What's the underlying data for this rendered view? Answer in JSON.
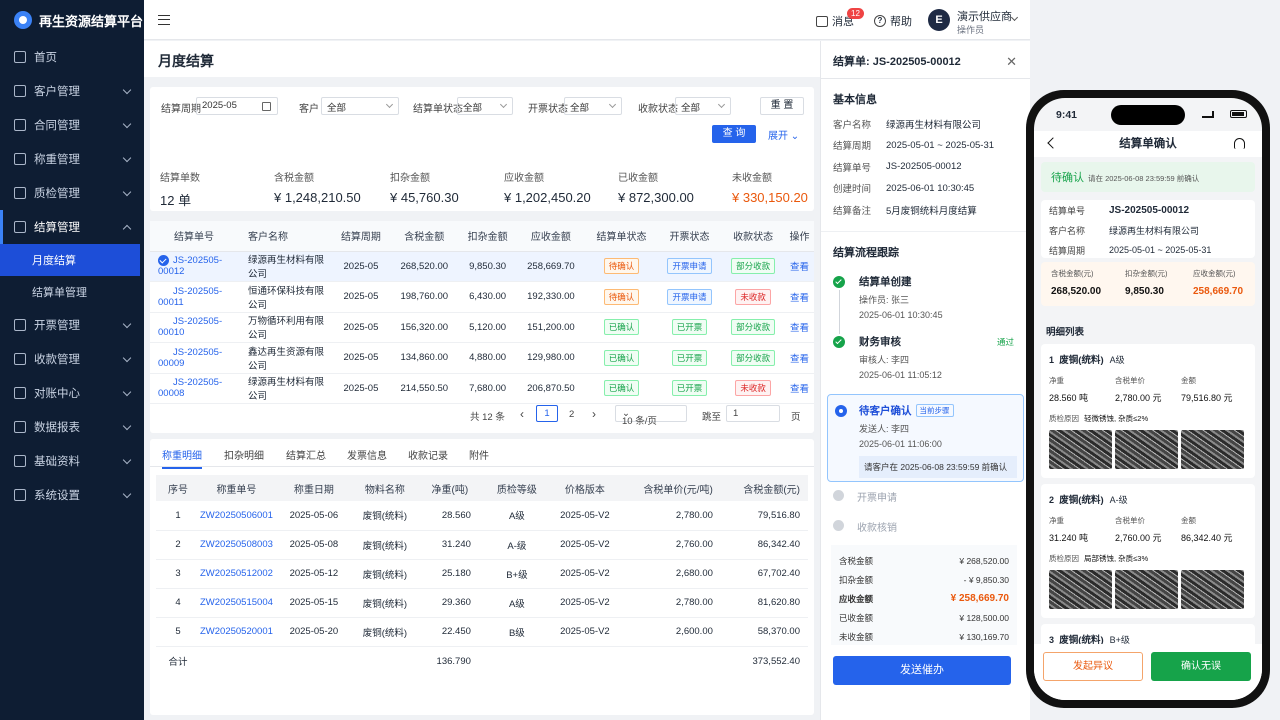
{
  "app": {
    "title": "再生资源结算平台"
  },
  "sidebar": {
    "items": [
      {
        "label": "首页"
      },
      {
        "label": "客户管理"
      },
      {
        "label": "合同管理"
      },
      {
        "label": "称重管理"
      },
      {
        "label": "质检管理"
      },
      {
        "label": "结算管理"
      },
      {
        "label": "月度结算"
      },
      {
        "label": "结算单管理"
      },
      {
        "label": "开票管理"
      },
      {
        "label": "收款管理"
      },
      {
        "label": "对账中心"
      },
      {
        "label": "数据报表"
      },
      {
        "label": "基础资料"
      },
      {
        "label": "系统设置"
      }
    ]
  },
  "topbar": {
    "messages": "消息",
    "message_count": "12",
    "help": "帮助",
    "avatar_letter": "E",
    "user_name": "演示供应商",
    "user_role": "操作员"
  },
  "page": {
    "title": "月度结算"
  },
  "filter": {
    "period_label": "结算周期",
    "period_value": "2025-05",
    "customer_label": "客户",
    "customer_value": "全部",
    "status_label": "结算单状态",
    "status_value": "全部",
    "invoice_label": "开票状态",
    "invoice_value": "全部",
    "payment_label": "收款状态",
    "payment_value": "全部",
    "reset": "重 置",
    "query": "查 询",
    "expand": "展开"
  },
  "stats": [
    {
      "label": "结算单数",
      "value": "12 单"
    },
    {
      "label": "含税金额",
      "value": "¥ 1,248,210.50"
    },
    {
      "label": "扣杂金额",
      "value": "¥ 45,760.30"
    },
    {
      "label": "应收金额",
      "value": "¥ 1,202,450.20"
    },
    {
      "label": "已收金额",
      "value": "¥ 872,300.00"
    },
    {
      "label": "未收金额",
      "value": "¥ 330,150.20"
    }
  ],
  "settlements": {
    "headers": [
      "结算单号",
      "客户名称",
      "结算周期",
      "含税金额",
      "扣杂金额",
      "应收金额",
      "结算单状态",
      "开票状态",
      "收款状态",
      "操作"
    ],
    "rows": [
      {
        "no": "JS-202505-00012",
        "customer": "绿源再生材料有限公司",
        "period": "2025-05",
        "tax": "268,520.00",
        "deduct": "9,850.30",
        "recv": "258,669.70",
        "status": "待确认",
        "invoice": "开票申请",
        "payment": "部分收款",
        "op": "查看"
      },
      {
        "no": "JS-202505-00011",
        "customer": "恒通环保科技有限公司",
        "period": "2025-05",
        "tax": "198,760.00",
        "deduct": "6,430.00",
        "recv": "192,330.00",
        "status": "待确认",
        "invoice": "开票申请",
        "payment": "未收款",
        "op": "查看"
      },
      {
        "no": "JS-202505-00010",
        "customer": "万物循环利用有限公司",
        "period": "2025-05",
        "tax": "156,320.00",
        "deduct": "5,120.00",
        "recv": "151,200.00",
        "status": "已确认",
        "invoice": "已开票",
        "payment": "部分收款",
        "op": "查看"
      },
      {
        "no": "JS-202505-00009",
        "customer": "鑫达再生资源有限公司",
        "period": "2025-05",
        "tax": "134,860.00",
        "deduct": "4,880.00",
        "recv": "129,980.00",
        "status": "已确认",
        "invoice": "已开票",
        "payment": "部分收款",
        "op": "查看"
      },
      {
        "no": "JS-202505-00008",
        "customer": "绿源再生材料有限公司",
        "period": "2025-05",
        "tax": "214,550.50",
        "deduct": "7,680.00",
        "recv": "206,870.50",
        "status": "已确认",
        "invoice": "已开票",
        "payment": "未收款",
        "op": "查看"
      }
    ]
  },
  "pager": {
    "total": "共 12 条",
    "page1": "1",
    "page2": "2",
    "size": "10 条/页",
    "goto": "跳至",
    "goto_value": "1",
    "page_unit": "页",
    "prev": "‹",
    "next": "›"
  },
  "detail_tabs": [
    "称重明细",
    "扣杂明细",
    "结算汇总",
    "发票信息",
    "收款记录",
    "附件"
  ],
  "weigh": {
    "headers": [
      "序号",
      "称重单号",
      "称重日期",
      "物料名称",
      "净重(吨)",
      "质检等级",
      "价格版本",
      "含税单价(元/吨)",
      "含税金额(元)"
    ],
    "rows": [
      {
        "i": "1",
        "no": "ZW20250506001",
        "date": "2025-05-06",
        "mat": "废铜(统料)",
        "net": "28.560",
        "grade": "A级",
        "ver": "2025-05-V2",
        "price": "2,780.00",
        "amt": "79,516.80"
      },
      {
        "i": "2",
        "no": "ZW20250508003",
        "date": "2025-05-08",
        "mat": "废铜(统料)",
        "net": "31.240",
        "grade": "A-级",
        "ver": "2025-05-V2",
        "price": "2,760.00",
        "amt": "86,342.40"
      },
      {
        "i": "3",
        "no": "ZW20250512002",
        "date": "2025-05-12",
        "mat": "废铜(统料)",
        "net": "25.180",
        "grade": "B+级",
        "ver": "2025-05-V2",
        "price": "2,680.00",
        "amt": "67,702.40"
      },
      {
        "i": "4",
        "no": "ZW20250515004",
        "date": "2025-05-15",
        "mat": "废铜(统料)",
        "net": "29.360",
        "grade": "A级",
        "ver": "2025-05-V2",
        "price": "2,780.00",
        "amt": "81,620.80"
      },
      {
        "i": "5",
        "no": "ZW20250520001",
        "date": "2025-05-20",
        "mat": "废铜(统料)",
        "net": "22.450",
        "grade": "B级",
        "ver": "2025-05-V2",
        "price": "2,600.00",
        "amt": "58,370.00"
      }
    ],
    "sum_label": "合计",
    "sum_net": "136.790",
    "sum_amt": "373,552.40"
  },
  "drawer": {
    "title": "结算单: JS-202505-00012",
    "basic_title": "基本信息",
    "basic": [
      {
        "k": "客户名称",
        "v": "绿源再生材料有限公司"
      },
      {
        "k": "结算周期",
        "v": "2025-05-01 ~ 2025-05-31"
      },
      {
        "k": "结算单号",
        "v": "JS-202505-00012"
      },
      {
        "k": "创建时间",
        "v": "2025-06-01 10:30:45"
      },
      {
        "k": "结算备注",
        "v": "5月废铜统料月度结算"
      }
    ],
    "flow_title": "结算流程跟踪",
    "steps": [
      {
        "title": "结算单创建",
        "who": "操作员: 张三",
        "time": "2025-06-01 10:30:45"
      },
      {
        "title": "财务审核",
        "who": "审核人: 李四",
        "time": "2025-06-01 11:05:12",
        "badge": "通过"
      }
    ],
    "current": {
      "title": "待客户确认",
      "tag": "当前步骤",
      "who": "发送人: 李四",
      "time": "2025-06-01 11:06:00",
      "note": "请客户在 2025-06-08 23:59:59 前确认"
    },
    "pending": [
      "开票申请",
      "收款核销"
    ],
    "amounts": [
      {
        "k": "含税金额",
        "v": "¥ 268,520.00"
      },
      {
        "k": "扣杂金额",
        "v": "- ¥ 9,850.30"
      },
      {
        "k": "应收金额",
        "v": "¥ 258,669.70"
      },
      {
        "k": "已收金额",
        "v": "¥ 128,500.00"
      },
      {
        "k": "未收金额",
        "v": "¥ 130,169.70"
      }
    ],
    "send_button": "发送催办"
  },
  "phone": {
    "time": "9:41",
    "title": "结算单确认",
    "status": "待确认",
    "status_note": "请在 2025-06-08 23:59:59 前确认",
    "info": [
      {
        "k": "结算单号",
        "v": "JS-202505-00012"
      },
      {
        "k": "客户名称",
        "v": "绿源再生材料有限公司"
      },
      {
        "k": "结算周期",
        "v": "2025-05-01 ~ 2025-05-31"
      }
    ],
    "amounts": [
      {
        "k": "含税金额(元)",
        "v": "268,520.00"
      },
      {
        "k": "扣杂金额(元)",
        "v": "9,850.30"
      },
      {
        "k": "应收金额(元)",
        "v": "258,669.70"
      }
    ],
    "list_title": "明细列表",
    "items": [
      {
        "idx": "1",
        "name": "废铜(统料)",
        "grade": "A级",
        "net": "28.560 吨",
        "price": "2,780.00 元",
        "amt": "79,516.80 元",
        "qa": "轻微锈蚀, 杂质≤2%"
      },
      {
        "idx": "2",
        "name": "废铜(统料)",
        "grade": "A-级",
        "net": "31.240 吨",
        "price": "2,760.00 元",
        "amt": "86,342.40 元",
        "qa": "局部锈蚀, 杂质≤3%"
      },
      {
        "idx": "3",
        "name": "废铜(统料)",
        "grade": "B+级"
      }
    ],
    "labels": {
      "net": "净重",
      "price": "含税单价",
      "amt": "金额",
      "qa": "质检原因"
    },
    "btn_dispute": "发起异议",
    "btn_confirm": "确认无误"
  }
}
